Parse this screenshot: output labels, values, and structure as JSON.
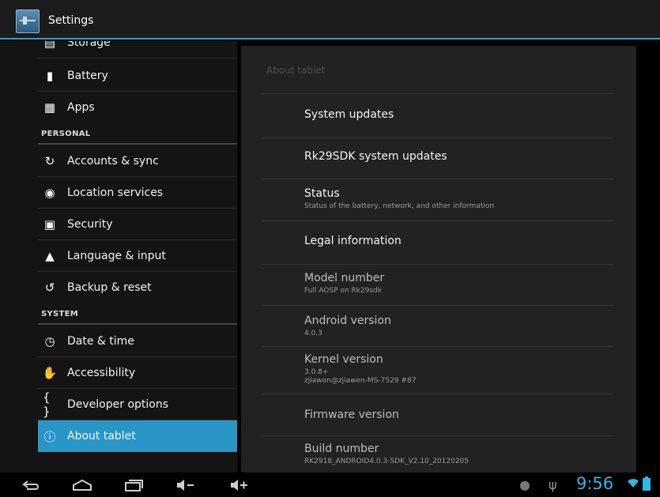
{
  "actionbar": {
    "title": "Settings"
  },
  "sidebar": {
    "items": [
      {
        "label": "Storage",
        "icon": "storage-icon"
      },
      {
        "label": "Battery",
        "icon": "battery-icon"
      },
      {
        "label": "Apps",
        "icon": "apps-icon"
      },
      {
        "label": "Accounts & sync",
        "icon": "sync-icon"
      },
      {
        "label": "Location services",
        "icon": "location-icon"
      },
      {
        "label": "Security",
        "icon": "lock-icon"
      },
      {
        "label": "Language & input",
        "icon": "language-icon"
      },
      {
        "label": "Backup & reset",
        "icon": "backup-icon"
      },
      {
        "label": "Date & time",
        "icon": "clock-icon"
      },
      {
        "label": "Accessibility",
        "icon": "hand-icon"
      },
      {
        "label": "Developer options",
        "icon": "braces-icon"
      },
      {
        "label": "About tablet",
        "icon": "info-icon",
        "selected": true
      }
    ],
    "headers": {
      "personal": "PERSONAL",
      "system": "SYSTEM"
    }
  },
  "about": {
    "title": "About tablet",
    "items": [
      {
        "title": "System updates",
        "summary": ""
      },
      {
        "title": "Rk29SDK system updates",
        "summary": ""
      },
      {
        "title": "Status",
        "summary": "Status of the battery, network, and other information"
      },
      {
        "title": "Legal information",
        "summary": ""
      },
      {
        "title": "Model number",
        "summary": "Full AOSP on Rk29sdk"
      },
      {
        "title": "Android version",
        "summary": "4.0.3"
      },
      {
        "title": "Kernel version",
        "summary": "3.0.8+",
        "summary2": "zjiawen@zjiawen-MS-7529 #87"
      },
      {
        "title": "Firmware version",
        "summary": ""
      },
      {
        "title": "Build number",
        "summary": "RK2918_ANDROID4.0.3-SDK_V2.10_20120205"
      }
    ]
  },
  "statusbar": {
    "time": "9:56"
  },
  "colors": {
    "accent": "#2a96c8",
    "clock": "#33b5e5",
    "background": "#000000"
  }
}
